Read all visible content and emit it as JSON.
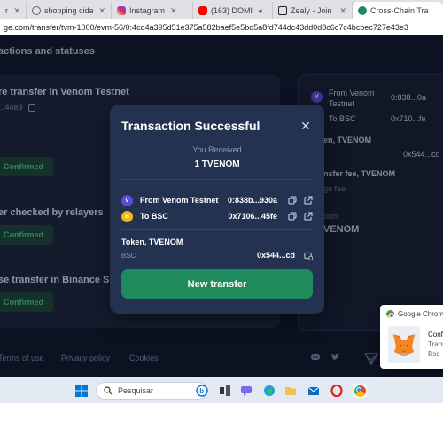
{
  "browser": {
    "tabs": [
      {
        "label": "nicial",
        "color": "#9aa0a6"
      },
      {
        "label": "shopping cidade",
        "color": "#5f6368"
      },
      {
        "label": "Instagram",
        "color": "#d6249f"
      },
      {
        "label": "(163) DOMI",
        "color": "#ff0000"
      },
      {
        "label": "Zealy - Join the",
        "color": "#202124"
      },
      {
        "label": "Cross-Chain Tra",
        "color": "#1f8a5c"
      }
    ],
    "url": "ge.com/transfer/tvm-1000/evm-56/0:4cd4a395d51e375a582baef5e5bd5a8fd744dc43dd0d8c6c7c4bcbec727e43e3"
  },
  "page": {
    "heading": "actions and statuses",
    "steps": [
      {
        "title": "re transfer in Venom Testnet",
        "hash": "...44e3",
        "status": "Confirmed"
      },
      {
        "title": "er checked by relayers",
        "status": "Confirmed"
      },
      {
        "title": "se transfer in Binance Sm",
        "status": "Confirmed"
      }
    ],
    "summary": {
      "from_label": "From Venom",
      "from_label2": "Testnet",
      "from_hash": "0:838...0a",
      "to_label": "To BSC",
      "to_hash": "0x710...fe",
      "token_label": "en, TVENOM",
      "token_hash": "0x544...cd",
      "fee_label": "nsfer fee, TVENOM",
      "fee_sub": "ge fee",
      "amount_label": "ount",
      "amount_value": "VENOM"
    },
    "footer": {
      "terms": "Terms of use",
      "privacy": "Privacy policy",
      "cookies": "Cookies"
    }
  },
  "modal": {
    "title": "Transaction Successful",
    "received_label": "You Received",
    "received_amount": "1 TVENOM",
    "from_network": "From Venom Testnet",
    "from_hash": "0:838b...930a",
    "to_network": "To BSC",
    "to_hash": "0x7106...45fe",
    "token_label": "Token, TVENOM",
    "bsc_label": "BSC",
    "bsc_hash": "0x544...cd",
    "button": "New transfer"
  },
  "notification": {
    "app": "Google Chrome",
    "line1": "Conf",
    "line2": "Trans",
    "line3": "Bsc"
  },
  "taskbar": {
    "search_placeholder": "Pesquisar"
  },
  "colors": {
    "page_bg": "#0f1627",
    "modal_bg": "#243252",
    "accent_green": "#1f8a5c",
    "confirmed_text": "#47c58b",
    "venom_purple": "#5b4bdb",
    "bsc_yellow": "#f0b90b"
  }
}
